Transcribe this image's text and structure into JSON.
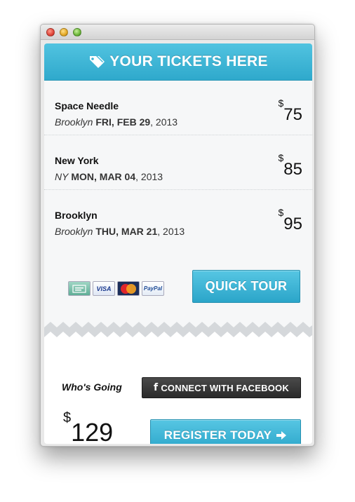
{
  "window": {
    "controls": [
      "close-light",
      "minimize-light",
      "zoom-light"
    ]
  },
  "header": {
    "icon": "tag-icon",
    "title": "YOUR TICKETS HERE"
  },
  "tickets": [
    {
      "name": "Space Needle",
      "location": "Brooklyn",
      "day": "FRI, FEB 29",
      "year": ", 2013",
      "currency": "$",
      "price": "75"
    },
    {
      "name": "New York",
      "location": "NY",
      "day": "MON, MAR 04",
      "year": ", 2013",
      "currency": "$",
      "price": "85"
    },
    {
      "name": "Brooklyn",
      "location": "Brooklyn",
      "day": "THU, MAR 21",
      "year": ", 2013",
      "currency": "$",
      "price": "95"
    }
  ],
  "payments": {
    "cards": [
      {
        "name": "amex-icon",
        "label": ""
      },
      {
        "name": "visa-icon",
        "label": "VISA"
      },
      {
        "name": "mastercard-icon",
        "label": ""
      },
      {
        "name": "paypal-icon",
        "label": "PayPal"
      }
    ]
  },
  "actions": {
    "quick_tour": "QUICK TOUR",
    "whos_going": "Who's Going",
    "facebook_icon": "f",
    "facebook": "CONNECT WITH FACEBOOK",
    "register": "REGISTER TODAY",
    "register_icon": "arrow-right-icon"
  },
  "total": {
    "currency": "$",
    "amount": "129"
  },
  "colors": {
    "accent": "#2fa9cc",
    "facebook_button": "#2a2a2a"
  }
}
